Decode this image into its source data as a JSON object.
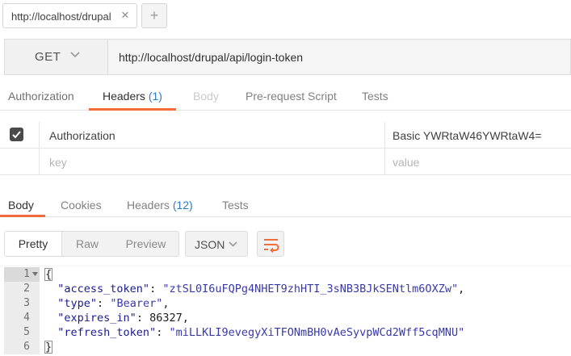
{
  "tab": {
    "title": "http://localhost/drupal",
    "close": "×",
    "add": "+"
  },
  "request": {
    "method": "GET",
    "url": "http://localhost/drupal/api/login-token"
  },
  "request_tabs": {
    "authorization": "Authorization",
    "headers": "Headers",
    "headers_count": "(1)",
    "body": "Body",
    "prerequest": "Pre-request Script",
    "tests": "Tests"
  },
  "headers": [
    {
      "checked": true,
      "key": "Authorization",
      "value": "Basic YWRtaW46YWRtaW4="
    },
    {
      "checked": false,
      "key_placeholder": "key",
      "value_placeholder": "value"
    }
  ],
  "response_tabs": {
    "body": "Body",
    "cookies": "Cookies",
    "headers": "Headers",
    "headers_count": "(12)",
    "tests": "Tests"
  },
  "view_modes": {
    "pretty": "Pretty",
    "raw": "Raw",
    "preview": "Preview",
    "selected": "Pretty"
  },
  "format": "JSON",
  "response_body": {
    "line_numbers": [
      "1",
      "2",
      "3",
      "4",
      "5",
      "6"
    ],
    "open_brace": "{",
    "close_brace": "}",
    "fields": [
      {
        "key": "\"access_token\"",
        "value": "\"ztSL0I6uFQPg4NHET9zhHTI_3sNB3BJkSENtlm6OXZw\"",
        "trail": ","
      },
      {
        "key": "\"type\"",
        "value": "\"Bearer\"",
        "trail": ","
      },
      {
        "key": "\"expires_in\"",
        "value": "86327",
        "trail": ","
      },
      {
        "key": "\"refresh_token\"",
        "value": "\"miLLKLI9evegyXiTFONmBH0vAeSyvpWCd2Wff5cqMNU\"",
        "trail": ""
      }
    ]
  },
  "colors": {
    "accent": "#f26b3a",
    "count": "#2a7cc7"
  }
}
